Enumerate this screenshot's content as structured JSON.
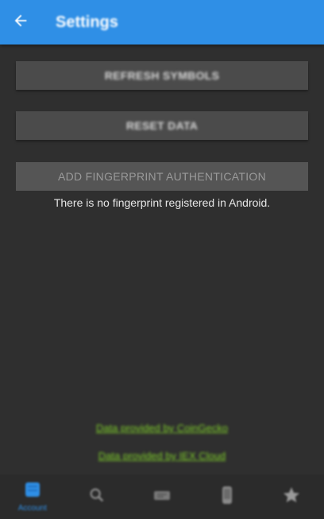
{
  "appbar": {
    "title": "Settings",
    "back_icon": "arrow-left-icon",
    "color": "#2f8fe6"
  },
  "buttons": {
    "refresh_label": "REFRESH SYMBOLS",
    "reset_label": "RESET DATA",
    "fingerprint_label": "ADD FINGERPRINT AUTHENTICATION"
  },
  "fingerprint_note": "There is no fingerprint registered in Android.",
  "footer_links": {
    "coingecko": "Data provided by CoinGecko",
    "iex": "Data provided by IEX Cloud"
  },
  "link_color": "#7fcf2a",
  "bottom_nav": {
    "items": [
      {
        "icon": "portfolio-icon",
        "label": "Account",
        "active": true
      },
      {
        "icon": "search-icon",
        "label": ""
      },
      {
        "icon": "ticket-icon",
        "label": ""
      },
      {
        "icon": "device-icon",
        "label": ""
      },
      {
        "icon": "star-icon",
        "label": ""
      }
    ],
    "active_color": "#2f8fe6",
    "inactive_color": "#8a8a8a"
  }
}
